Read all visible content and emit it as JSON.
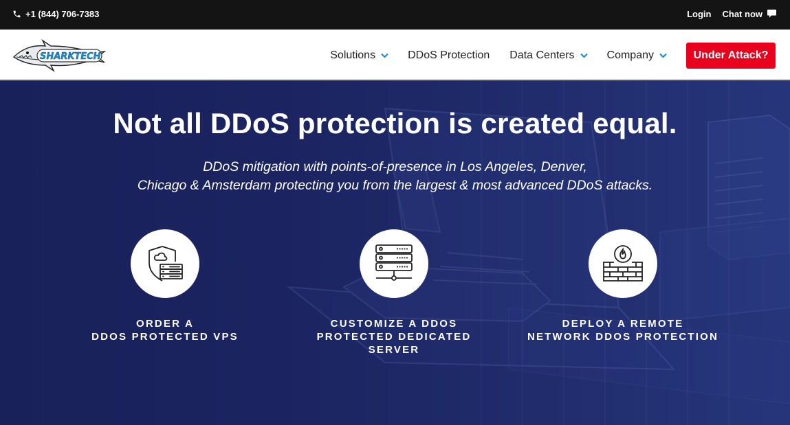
{
  "topbar": {
    "phone": "+1 (844) 706-7383",
    "login": "Login",
    "chat": "Chat now"
  },
  "nav": {
    "logo_text": "SHARKTECH",
    "items": [
      {
        "label": "Solutions",
        "dropdown": true
      },
      {
        "label": "DDoS Protection",
        "dropdown": false
      },
      {
        "label": "Data Centers",
        "dropdown": true
      },
      {
        "label": "Company",
        "dropdown": true
      }
    ],
    "cta": "Under Attack?"
  },
  "hero": {
    "title": "Not all DDoS protection is created equal.",
    "subtitle_line1": "DDoS mitigation with points-of-presence in Los Angeles, Denver,",
    "subtitle_line2": "Chicago & Amsterdam protecting you from the largest & most advanced DDoS attacks."
  },
  "cards": [
    {
      "icon": "shield-cloud-server-icon",
      "line1": "ORDER A",
      "line2": "DDOS PROTECTED VPS",
      "line3": ""
    },
    {
      "icon": "server-network-icon",
      "line1": "CUSTOMIZE A DDOS",
      "line2": "PROTECTED DEDICATED",
      "line3": "SERVER"
    },
    {
      "icon": "firewall-icon",
      "line1": "DEPLOY A REMOTE",
      "line2": "NETWORK DDOS PROTECTION",
      "line3": ""
    }
  ],
  "colors": {
    "accent_red": "#e8001c",
    "chevron_blue": "#1a8fd6",
    "hero_navy": "#1b2460",
    "topbar_black": "#141414"
  }
}
